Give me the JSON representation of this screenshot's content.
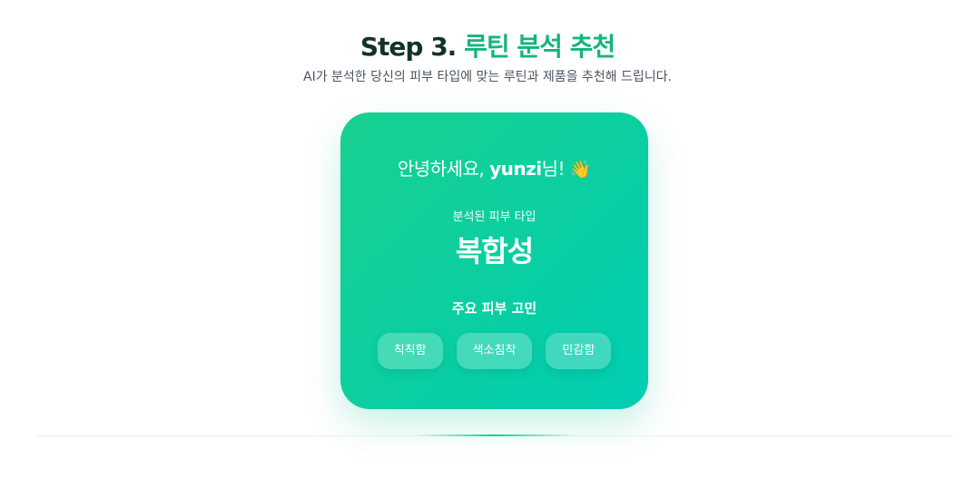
{
  "header": {
    "step": "Step 3.",
    "title": "루틴 분석 추천",
    "subtitle": "AI가 분석한 당신의 피부 타입에 맞는 루틴과 제품을 추천해 드립니다."
  },
  "card": {
    "greeting_prefix": "안녕하세요, ",
    "user_name": "yunzi",
    "greeting_suffix": "님! ",
    "greeting_emoji": "👋",
    "skin_type_label": "분석된 피부 타입",
    "skin_type": "복합성",
    "concerns_label": "주요 피부 고민",
    "concerns": [
      "칙칙함",
      "색소침착",
      "민감함"
    ]
  },
  "colors": {
    "accent": "#15b57e",
    "card_start": "#18d090",
    "card_end": "#00cdb3"
  }
}
